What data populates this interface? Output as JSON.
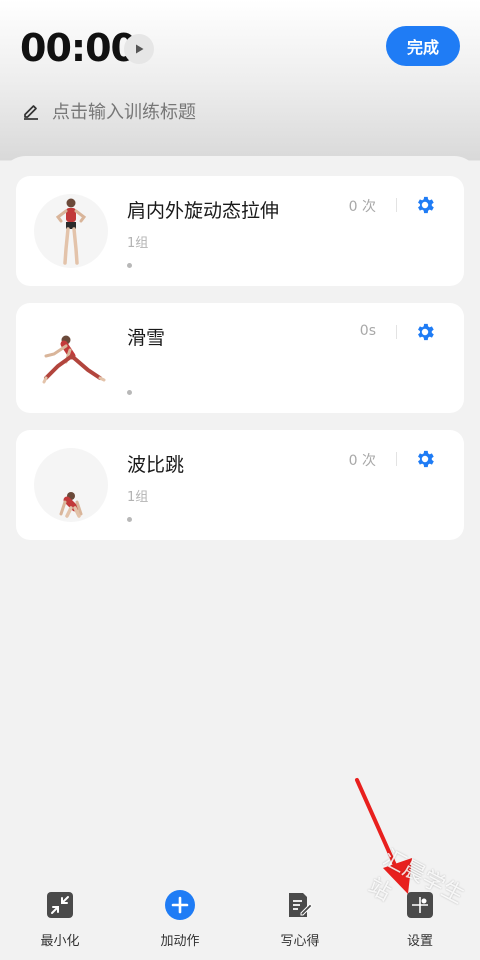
{
  "header": {
    "timer": "00:00",
    "done_label": "完成",
    "title_placeholder": "点击输入训练标题"
  },
  "exercises": [
    {
      "name": "肩内外旋动态拉伸",
      "sets": "1组",
      "count": "0 次"
    },
    {
      "name": "滑雪",
      "sets": "",
      "count": "0s"
    },
    {
      "name": "波比跳",
      "sets": "1组",
      "count": "0 次"
    }
  ],
  "bottom_tabs": [
    {
      "label": "最小化",
      "icon": "minimize-icon"
    },
    {
      "label": "加动作",
      "icon": "add-circle-icon"
    },
    {
      "label": "写心得",
      "icon": "note-edit-icon"
    },
    {
      "label": "设置",
      "icon": "settings-icon"
    }
  ],
  "watermark": "汇晨学生站",
  "colors": {
    "accent": "#1f7cf5",
    "annotation_arrow": "#e8201e"
  }
}
